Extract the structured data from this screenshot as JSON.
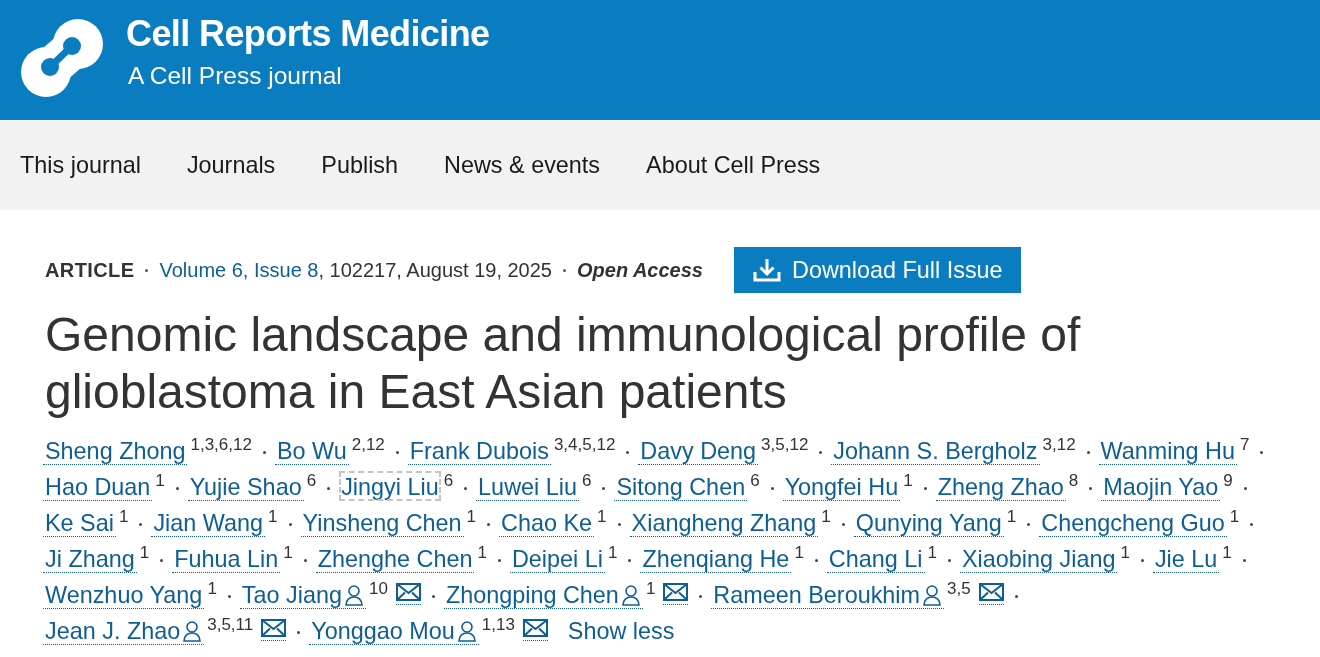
{
  "header": {
    "journal_title": "Cell Reports Medicine",
    "tagline": "A Cell Press journal"
  },
  "nav": {
    "items": [
      "This journal",
      "Journals",
      "Publish",
      "News & events",
      "About Cell Press"
    ]
  },
  "article": {
    "type": "ARTICLE",
    "issue_link": "Volume 6, Issue 8",
    "citation": ", 102217, August 19, 2025",
    "access": "Open Access",
    "download_button": "Download Full Issue",
    "title": "Genomic landscape and immunological profile of glioblastoma in East Asian patients",
    "authors": [
      {
        "name": "Sheng Zhong",
        "affiliations": "1,3,6,12",
        "corresponding": false,
        "focused": false
      },
      {
        "name": "Bo Wu",
        "affiliations": "2,12",
        "corresponding": false,
        "focused": false
      },
      {
        "name": "Frank Dubois",
        "affiliations": "3,4,5,12",
        "corresponding": false,
        "focused": false
      },
      {
        "name": "Davy Deng",
        "affiliations": "3,5,12",
        "corresponding": false,
        "focused": false
      },
      {
        "name": "Johann S. Bergholz",
        "affiliations": "3,12",
        "corresponding": false,
        "focused": false
      },
      {
        "name": "Wanming Hu",
        "affiliations": "7",
        "corresponding": false,
        "focused": false
      },
      {
        "name": "Hao Duan",
        "affiliations": "1",
        "corresponding": false,
        "focused": false
      },
      {
        "name": "Yujie Shao",
        "affiliations": "6",
        "corresponding": false,
        "focused": false
      },
      {
        "name": "Jingyi Liu",
        "affiliations": "6",
        "corresponding": false,
        "focused": true
      },
      {
        "name": "Luwei Liu",
        "affiliations": "6",
        "corresponding": false,
        "focused": false
      },
      {
        "name": "Sitong Chen",
        "affiliations": "6",
        "corresponding": false,
        "focused": false
      },
      {
        "name": "Yongfei Hu",
        "affiliations": "1",
        "corresponding": false,
        "focused": false
      },
      {
        "name": "Zheng Zhao",
        "affiliations": "8",
        "corresponding": false,
        "focused": false
      },
      {
        "name": "Maojin Yao",
        "affiliations": "9",
        "corresponding": false,
        "focused": false
      },
      {
        "name": "Ke Sai",
        "affiliations": "1",
        "corresponding": false,
        "focused": false
      },
      {
        "name": "Jian Wang",
        "affiliations": "1",
        "corresponding": false,
        "focused": false
      },
      {
        "name": "Yinsheng Chen",
        "affiliations": "1",
        "corresponding": false,
        "focused": false
      },
      {
        "name": "Chao Ke",
        "affiliations": "1",
        "corresponding": false,
        "focused": false
      },
      {
        "name": "Xiangheng Zhang",
        "affiliations": "1",
        "corresponding": false,
        "focused": false
      },
      {
        "name": "Qunying Yang",
        "affiliations": "1",
        "corresponding": false,
        "focused": false
      },
      {
        "name": "Chengcheng Guo",
        "affiliations": "1",
        "corresponding": false,
        "focused": false
      },
      {
        "name": "Ji Zhang",
        "affiliations": "1",
        "corresponding": false,
        "focused": false
      },
      {
        "name": "Fuhua Lin",
        "affiliations": "1",
        "corresponding": false,
        "focused": false
      },
      {
        "name": "Zhenghe Chen",
        "affiliations": "1",
        "corresponding": false,
        "focused": false
      },
      {
        "name": "Deipei Li",
        "affiliations": "1",
        "corresponding": false,
        "focused": false
      },
      {
        "name": "Zhenqiang He",
        "affiliations": "1",
        "corresponding": false,
        "focused": false
      },
      {
        "name": "Chang Li",
        "affiliations": "1",
        "corresponding": false,
        "focused": false
      },
      {
        "name": "Xiaobing Jiang",
        "affiliations": "1",
        "corresponding": false,
        "focused": false
      },
      {
        "name": "Jie Lu",
        "affiliations": "1",
        "corresponding": false,
        "focused": false
      },
      {
        "name": "Wenzhuo Yang",
        "affiliations": "1",
        "corresponding": false,
        "focused": false
      },
      {
        "name": "Tao Jiang",
        "affiliations": "10",
        "corresponding": true,
        "focused": false
      },
      {
        "name": "Zhongping Chen",
        "affiliations": "1",
        "corresponding": true,
        "focused": false
      },
      {
        "name": "Rameen Beroukhim",
        "affiliations": "3,5",
        "corresponding": true,
        "focused": false
      },
      {
        "name": "Jean J. Zhao",
        "affiliations": "3,5,11",
        "corresponding": true,
        "focused": false
      },
      {
        "name": "Yonggao Mou",
        "affiliations": "1,13",
        "corresponding": true,
        "focused": false
      }
    ],
    "show_less": "Show less"
  }
}
